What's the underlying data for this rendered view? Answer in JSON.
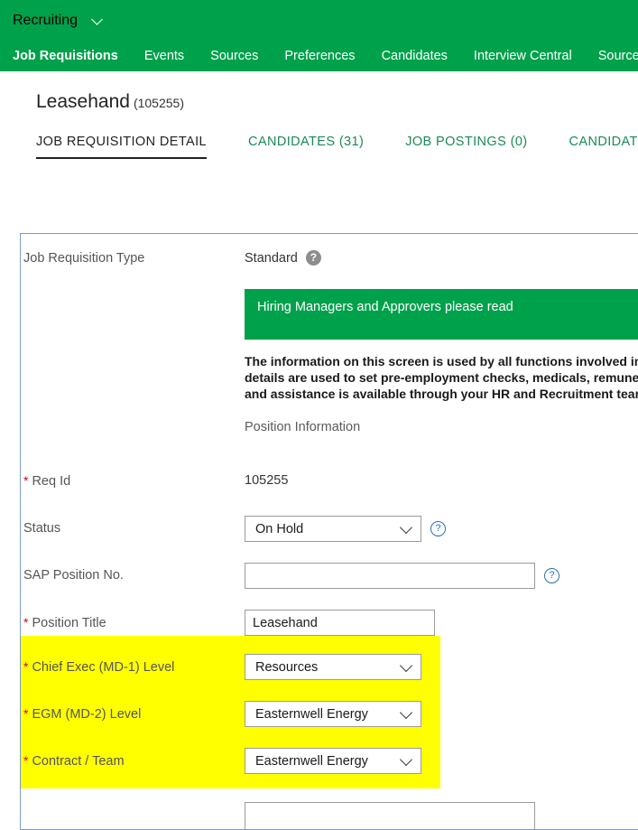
{
  "topbar": {
    "module_label": "Recruiting",
    "caret_icon": "chevron-down-icon",
    "nav_items": [
      {
        "label": "Job Requisitions",
        "active": true
      },
      {
        "label": "Events",
        "active": false
      },
      {
        "label": "Sources",
        "active": false
      },
      {
        "label": "Preferences",
        "active": false
      },
      {
        "label": "Candidates",
        "active": false
      },
      {
        "label": "Interview Central",
        "active": false
      },
      {
        "label": "Source Tracker",
        "active": false
      }
    ],
    "background": "#00a14b"
  },
  "page_header": {
    "title": "Leasehand",
    "req_id_display": "(105255)"
  },
  "subtabs": [
    {
      "label": "JOB REQUISITION DETAIL",
      "active": true
    },
    {
      "label": "CANDIDATES (31)",
      "active": false
    },
    {
      "label": "JOB POSTINGS (0)",
      "active": false
    },
    {
      "label": "CANDIDATE SEARCH",
      "active": false
    }
  ],
  "form": {
    "req_type": {
      "label": "Job Requisition Type",
      "value": "Standard",
      "help_icon": "help-question-icon"
    },
    "banner": {
      "text": "Hiring Managers and Approvers please read",
      "background": "#00a14b"
    },
    "info_paragraph": "The information on this screen is used by all functions involved in hiring.\ndetails are used to set pre-employment checks, medicals, remuneration\nand assistance is available through your HR and Recruitment team.",
    "section_heading": "Position Information",
    "req_id": {
      "label": "Req Id",
      "required": "*",
      "value": "105255"
    },
    "status": {
      "label": "Status",
      "value": "On Hold",
      "help_icon": "help-question-icon",
      "chevron_icon": "chevron-down-icon"
    },
    "sap_position_no": {
      "label": "SAP Position No.",
      "value": "",
      "placeholder": "",
      "help_icon": "help-question-icon"
    },
    "position_title": {
      "label": "Position Title",
      "required": "*",
      "value": "Leasehand"
    },
    "chief_exec_level": {
      "label": "Chief Exec (MD-1) Level",
      "required": "*",
      "value": "Resources",
      "chevron_icon": "chevron-down-icon",
      "highlight_color": "#ffff00"
    },
    "egm_level": {
      "label": "EGM (MD-2) Level",
      "required": "*",
      "value": "Easternwell Energy",
      "chevron_icon": "chevron-down-icon",
      "highlight_color": "#ffff00"
    },
    "contract_team": {
      "label": "Contract / Team",
      "required": "*",
      "value": "Easternwell Energy",
      "chevron_icon": "chevron-down-icon",
      "highlight_color": "#ffff00"
    }
  },
  "colors": {
    "brand_green": "#00a14b",
    "link_green": "#1a8a55",
    "panel_border": "#7b9dc7",
    "required_red": "#d0021b",
    "highlight_yellow": "#ffff00",
    "help_blue": "#2a6ebb"
  }
}
